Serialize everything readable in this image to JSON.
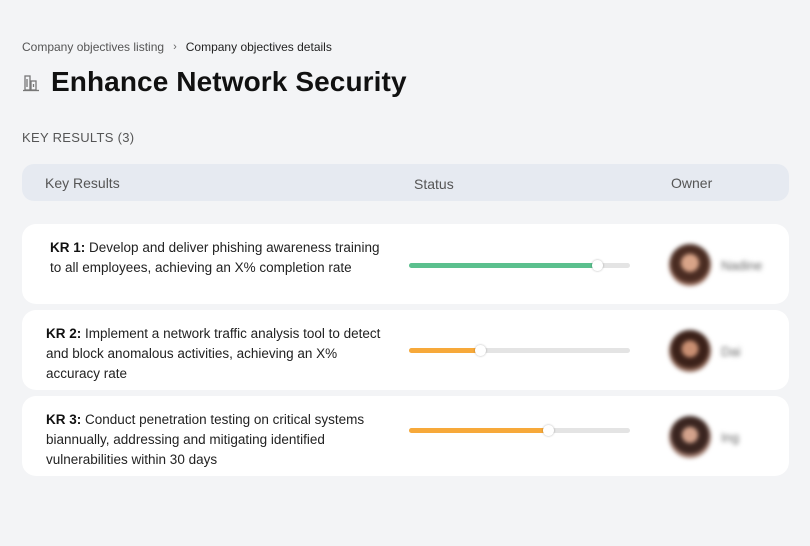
{
  "breadcrumb": {
    "parent": "Company objectives listing",
    "current": "Company objectives details"
  },
  "title": "Enhance Network Security",
  "section_label": "KEY RESULTS (3)",
  "table": {
    "headers": {
      "key_results": "Key Results",
      "status": "Status",
      "owner": "Owner"
    }
  },
  "key_results": [
    {
      "id": "KR 1:",
      "text": "Develop and deliver phishing awareness training to all employees, achieving an X% completion rate",
      "progress": 0.85,
      "color": "#5bc08e",
      "owner": "Nadine"
    },
    {
      "id": "KR 2:",
      "text": "Implement a network traffic analysis tool to detect and block anomalous activities, achieving an X% accuracy rate",
      "progress": 0.32,
      "color": "#f7a93a",
      "owner": "Dai"
    },
    {
      "id": "KR 3:",
      "text": "Conduct penetration testing on critical systems biannually, addressing and mitigating identified vulnerabilities within 30 days",
      "progress": 0.63,
      "color": "#f7a93a",
      "owner": "Ing"
    }
  ],
  "icons": {
    "title_icon": "building-icon",
    "breadcrumb_separator": "chevron-right-icon"
  }
}
